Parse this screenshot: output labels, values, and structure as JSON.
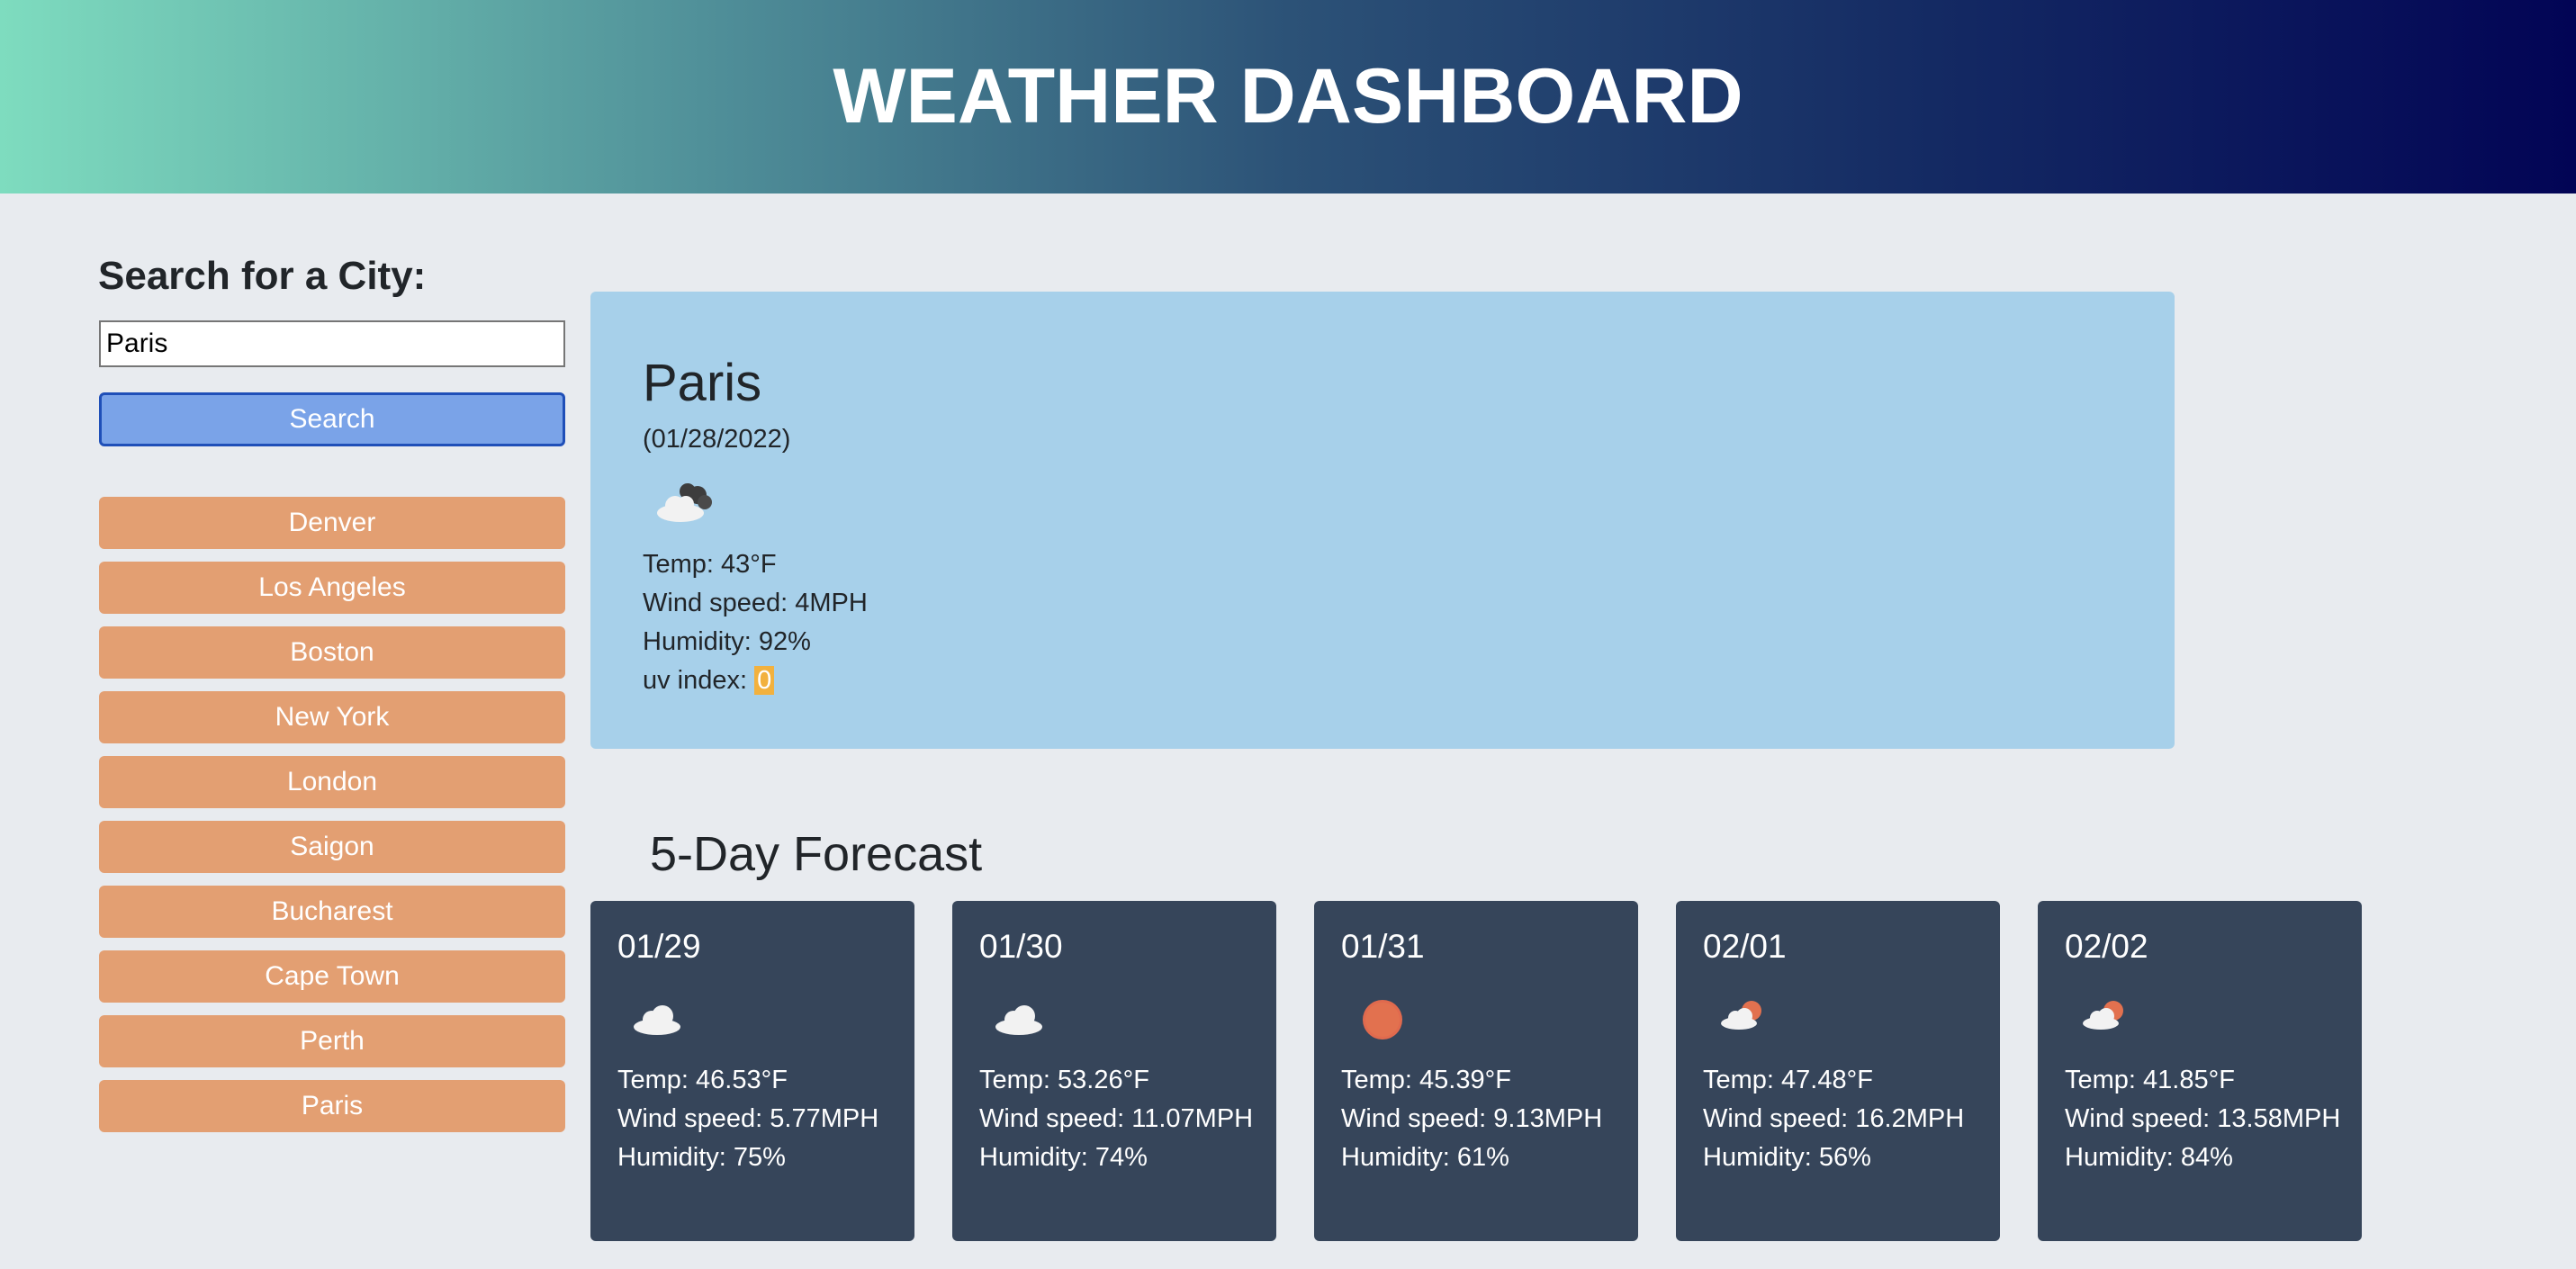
{
  "header": {
    "title": "WEATHER DASHBOARD"
  },
  "search": {
    "label": "Search for a City:",
    "input_value": "Paris",
    "button_label": "Search"
  },
  "history": [
    "Denver",
    "Los Angeles",
    "Boston",
    "New York",
    "London",
    "Saigon",
    "Bucharest",
    "Cape Town",
    "Perth",
    "Paris"
  ],
  "current": {
    "city": "Paris",
    "date": "(01/28/2022)",
    "icon": "broken-clouds-icon",
    "temp": "Temp: 43°F",
    "wind": "Wind speed: 4MPH",
    "humidity": "Humidity: 92%",
    "uv_label": "uv index: ",
    "uv_value": "0",
    "uv_color": "#f2b13e"
  },
  "forecast": {
    "title": "5-Day Forecast",
    "days": [
      {
        "date": "01/29",
        "icon": "cloud-icon",
        "temp": "Temp: 46.53°F",
        "wind": "Wind speed: 5.77MPH",
        "humidity": "Humidity: 75%"
      },
      {
        "date": "01/30",
        "icon": "cloud-icon",
        "temp": "Temp: 53.26°F",
        "wind": "Wind speed: 11.07MPH",
        "humidity": "Humidity: 74%"
      },
      {
        "date": "01/31",
        "icon": "sun-icon",
        "temp": "Temp: 45.39°F",
        "wind": "Wind speed: 9.13MPH",
        "humidity": "Humidity: 61%"
      },
      {
        "date": "02/01",
        "icon": "partly-cloudy-icon",
        "temp": "Temp: 47.48°F",
        "wind": "Wind speed: 16.2MPH",
        "humidity": "Humidity: 56%"
      },
      {
        "date": "02/02",
        "icon": "partly-cloudy-icon",
        "temp": "Temp: 41.85°F",
        "wind": "Wind speed: 13.58MPH",
        "humidity": "Humidity: 84%"
      }
    ]
  },
  "colors": {
    "accent_search": "#7aa3e8",
    "history_button": "#e39f72",
    "current_card": "#a7d0ea",
    "forecast_card": "#36455a"
  }
}
